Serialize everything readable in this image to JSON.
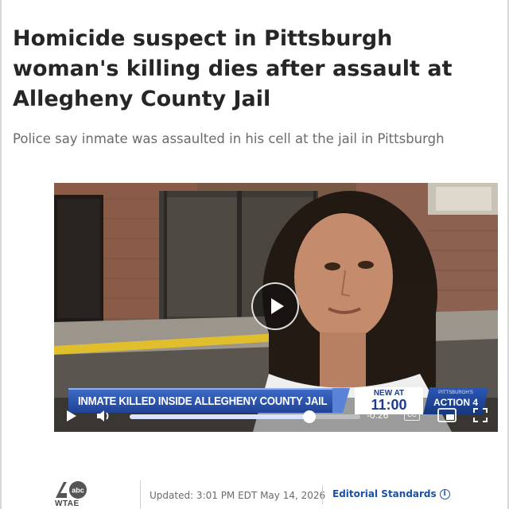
{
  "article": {
    "headline": "Homicide suspect in Pittsburgh woman's killing dies after assault at Allegheny County Jail",
    "subtitle": "Police say inmate was assaulted in his cell at the jail in Pittsburgh"
  },
  "video": {
    "lower_third": "INMATE KILLED INSIDE ALLEGHENY COUNTY JAIL",
    "news_at_label": "NEW AT",
    "news_time": "11:00",
    "station_small": "PITTSBURGH'S",
    "station_brand": "ACTION 4",
    "time_remaining": "-0:26",
    "progress": 0.78,
    "controls": {
      "cc_label": "CC"
    }
  },
  "footer": {
    "logo_text": "WTAE",
    "updated": "Updated: 3:01 PM EDT May 14, 2026",
    "editorial_label": "Editorial Standards",
    "info_glyph": "i"
  },
  "colors": {
    "headline": "#262626",
    "subtitle": "#6b6b6b",
    "link": "#1c4fa8",
    "lower_third": "#2a52b0"
  },
  "icons": [
    "play-icon",
    "volume-icon",
    "closed-captions-icon",
    "picture-in-picture-icon",
    "fullscreen-icon",
    "info-icon",
    "abc-logo"
  ]
}
